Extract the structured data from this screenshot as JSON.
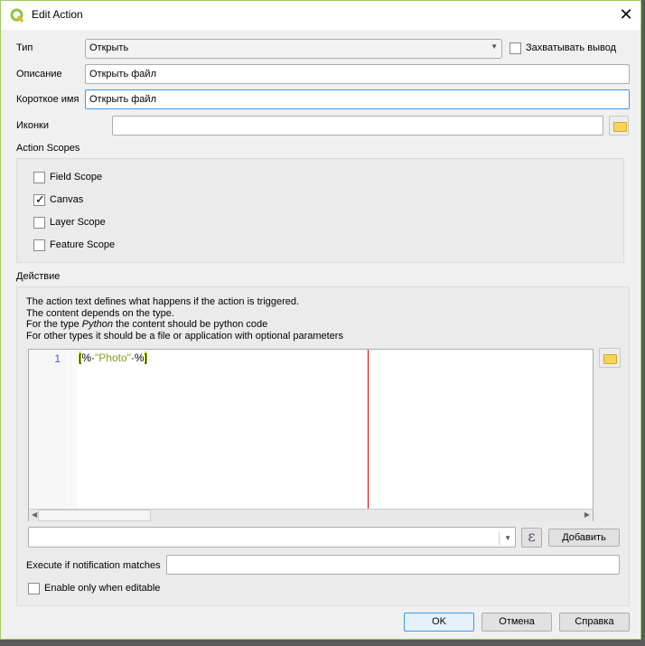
{
  "window": {
    "title": "Edit Action",
    "close": "✕"
  },
  "form": {
    "type_label": "Тип",
    "type_value": "Открыть",
    "capture_label": "Захватывать вывод",
    "capture_checked": false,
    "description_label": "Описание",
    "description_value": "Открыть файл",
    "short_name_label": "Короткое имя",
    "short_name_value": "Открыть файл",
    "icon_label": "Иконки",
    "icon_value": ""
  },
  "scopes": {
    "label": "Action Scopes",
    "items": [
      {
        "label": "Field Scope",
        "checked": false
      },
      {
        "label": "Canvas",
        "checked": true
      },
      {
        "label": "Layer Scope",
        "checked": false
      },
      {
        "label": "Feature Scope",
        "checked": false
      }
    ]
  },
  "action": {
    "label": "Действие",
    "help": [
      "The action text defines what happens if the action is triggered.",
      "The content depends on the type."
    ],
    "help3_pre": "For the type ",
    "help3_em": "Python",
    "help3_post": " the content should be python code",
    "help4": "For other types it should be a file or application with optional parameters",
    "line_number": "1",
    "code_open": "[",
    "code_mid1": "%·",
    "code_str": "\"Photo\"",
    "code_mid2": "·%",
    "code_close": "]",
    "insert_value": "",
    "epsilon": "ε",
    "add_label": "Добавить",
    "notify_label": "Execute if notification matches",
    "notify_value": "",
    "editable_label": "Enable only when editable",
    "editable_checked": false
  },
  "buttons": {
    "ok": "OK",
    "cancel": "Отмена",
    "help": "Справка"
  }
}
